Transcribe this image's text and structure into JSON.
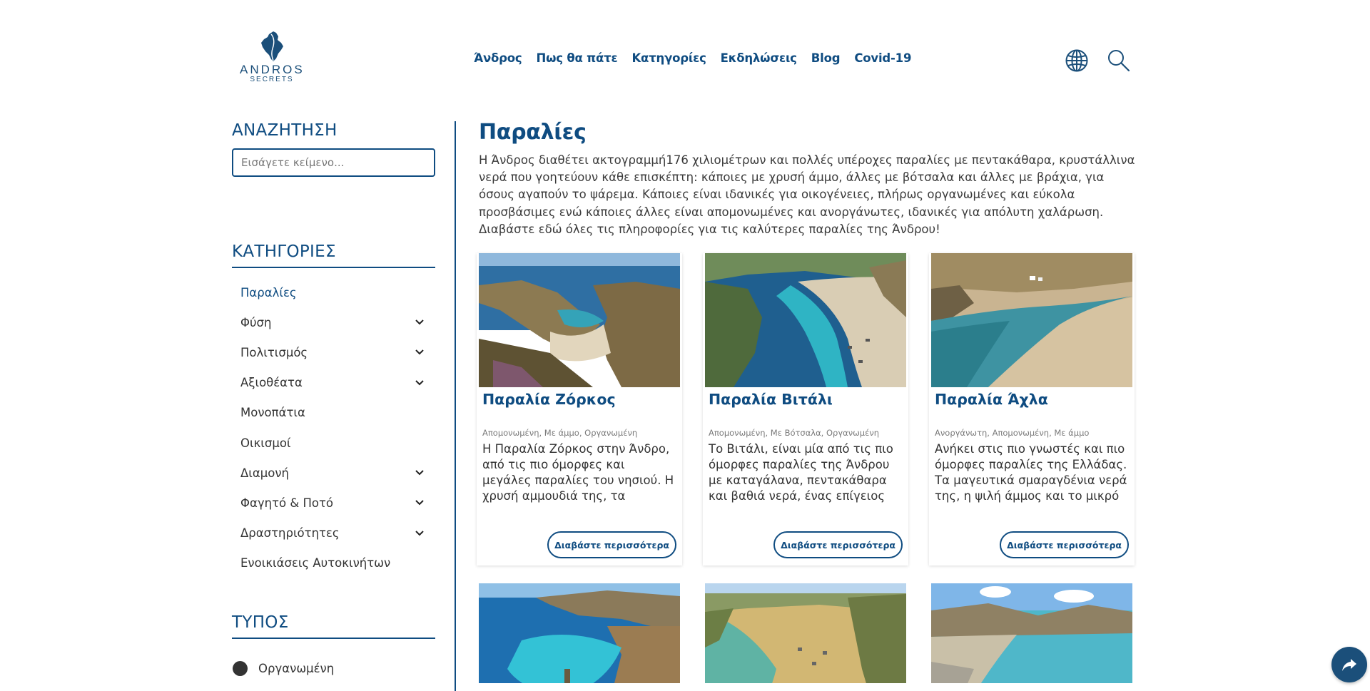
{
  "brand": {
    "name": "ANDROS",
    "tagline": "SECRETS"
  },
  "nav": {
    "items": [
      "Άνδρος",
      "Πως θα πάτε",
      "Κατηγορίες",
      "Εκδηλώσεις",
      "Blog",
      "Covid-19"
    ]
  },
  "header_icons": [
    "globe-icon",
    "search-icon"
  ],
  "sidebar": {
    "search_title": "ΑΝΑΖΗΤΗΣΗ",
    "search_placeholder": "Εισάγετε κείμενο...",
    "categories_title": "ΚΑΤΗΓΟΡΙΕΣ",
    "categories": [
      {
        "label": "Παραλίες",
        "expandable": false,
        "active": true
      },
      {
        "label": "Φύση",
        "expandable": true
      },
      {
        "label": "Πολιτισμός",
        "expandable": true
      },
      {
        "label": "Αξιοθέατα",
        "expandable": true
      },
      {
        "label": "Μονοπάτια",
        "expandable": false
      },
      {
        "label": "Οικισμοί",
        "expandable": false
      },
      {
        "label": "Διαμονή",
        "expandable": true
      },
      {
        "label": "Φαγητό & Ποτό",
        "expandable": true
      },
      {
        "label": "Δραστηριότητες",
        "expandable": true
      },
      {
        "label": "Ενοικιάσεις Αυτοκινήτων",
        "expandable": false
      }
    ],
    "type_title": "ΤΥΠΟΣ",
    "types": [
      "Οργανωμένη"
    ]
  },
  "main": {
    "title": "Παραλίες",
    "intro": "Η Άνδρος διαθέτει ακτογραμμή176 χιλιομέτρων και πολλές υπέροχες παραλίες με πεντακάθαρα, κρυστάλλινα νερά που γοητεύουν κάθε επισκέπτη: κάποιες με χρυσή άμμο, άλλες με βότσαλα και άλλες με βράχια, για όσους αγαπούν το ψάρεμα. Κάποιες είναι ιδανικές για οικογένειες, πλήρως οργανωμένες και εύκολα προσβάσιμες ενώ κάποιες άλλες είναι απομονωμένες και ανοργάνωτες, ιδανικές για απόλυτη χαλάρωση. Διαβάστε εδώ όλες τις πληροφορίες για τις καλύτερες παραλίες της Άνδρου!",
    "read_more": "Διαβάστε περισσότερα",
    "cards": [
      {
        "title": "Παραλία Ζόρκος",
        "tags": "Απομονωμένη, Με άμμο, Οργανωμένη",
        "desc": "Η Παραλία Ζόρκος στην Άνδρο, από τις πιο όμορφες και μεγάλες παραλίες του νησιού. Η χρυσή αμμουδιά της, τα επιβλητικά"
      },
      {
        "title": "Παραλία Βιτάλι",
        "tags": "Απομονωμένη, Με Βότσαλα, Οργανωμένη",
        "desc": "Το Βιτάλι, είναι μία από τις πιο όμορφες παραλίες της Άνδρου με καταγάλανα, πεντακάθαρα και βαθιά νερά, ένας επίγειος"
      },
      {
        "title": "Παραλία Άχλα",
        "tags": "Ανοργάνωτη, Απομονωμένη, Με άμμο",
        "desc": "Ανήκει στις πιο γνωστές και πιο όμορφες παραλίες της Ελλάδας. Τα μαγευτικά σμαραγδένια νερά της, η ψιλή άμμος και το μικρό λευκό"
      }
    ]
  },
  "colors": {
    "accent": "#0f4c81",
    "text": "#333333",
    "tags": "#7a7a7a"
  },
  "share_button_icon": "share-icon"
}
